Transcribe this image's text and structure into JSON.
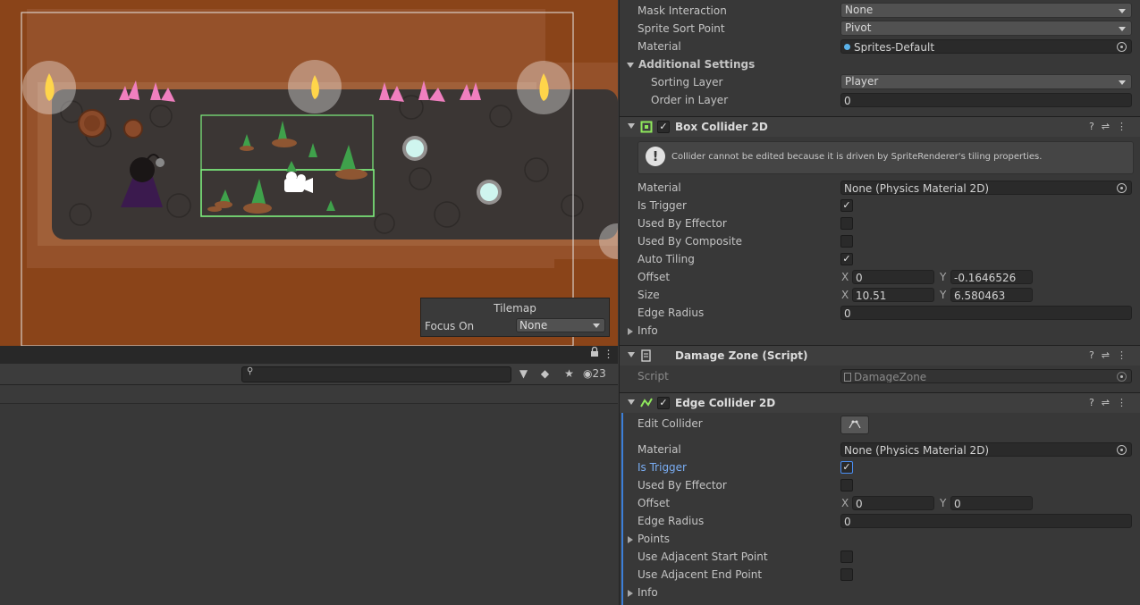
{
  "scene": {
    "tilemap_overlay": {
      "title": "Tilemap",
      "focus_label": "Focus On",
      "focus_value": "None"
    },
    "colors": {
      "dirt": "#8a4419",
      "floor": "#3b3634",
      "selection": "#7ef07e"
    }
  },
  "hierarchy": {
    "search_placeholder": "",
    "hidden_count": "23",
    "icons": [
      "lock-icon",
      "more-icon",
      "filter-icon",
      "tag-icon",
      "star-icon",
      "visibility-icon"
    ]
  },
  "inspector": {
    "sprite_renderer": {
      "mask_interaction_label": "Mask Interaction",
      "mask_interaction_value": "None",
      "sprite_sort_point_label": "Sprite Sort Point",
      "sprite_sort_point_value": "Pivot",
      "material_label": "Material",
      "material_value": "Sprites-Default",
      "additional_settings_label": "Additional Settings",
      "sorting_layer_label": "Sorting Layer",
      "sorting_layer_value": "Player",
      "order_in_layer_label": "Order in Layer",
      "order_in_layer_value": "0"
    },
    "box_collider": {
      "title": "Box Collider 2D",
      "help_text": "Collider cannot be edited because it is driven by SpriteRenderer's tiling properties.",
      "material_label": "Material",
      "material_value": "None (Physics Material 2D)",
      "is_trigger_label": "Is Trigger",
      "is_trigger": true,
      "used_by_effector_label": "Used By Effector",
      "used_by_effector": false,
      "used_by_composite_label": "Used By Composite",
      "used_by_composite": false,
      "auto_tiling_label": "Auto Tiling",
      "auto_tiling": true,
      "offset_label": "Offset",
      "offset_x": "0",
      "offset_y": "-0.1646526",
      "size_label": "Size",
      "size_x": "10.51",
      "size_y": "6.580463",
      "edge_radius_label": "Edge Radius",
      "edge_radius_value": "0",
      "info_label": "Info"
    },
    "damage_zone": {
      "title": "Damage Zone (Script)",
      "script_label": "Script",
      "script_value": "DamageZone"
    },
    "edge_collider": {
      "title": "Edge Collider 2D",
      "edit_collider_label": "Edit Collider",
      "material_label": "Material",
      "material_value": "None (Physics Material 2D)",
      "is_trigger_label": "Is Trigger",
      "is_trigger": true,
      "used_by_effector_label": "Used By Effector",
      "used_by_effector": false,
      "offset_label": "Offset",
      "offset_x": "0",
      "offset_y": "0",
      "edge_radius_label": "Edge Radius",
      "edge_radius_value": "0",
      "points_label": "Points",
      "use_adj_start_label": "Use Adjacent Start Point",
      "use_adj_start": false,
      "use_adj_end_label": "Use Adjacent End Point",
      "use_adj_end": false,
      "info_label": "Info"
    },
    "axis": {
      "x": "X",
      "y": "Y"
    },
    "check_glyph": "✓"
  }
}
